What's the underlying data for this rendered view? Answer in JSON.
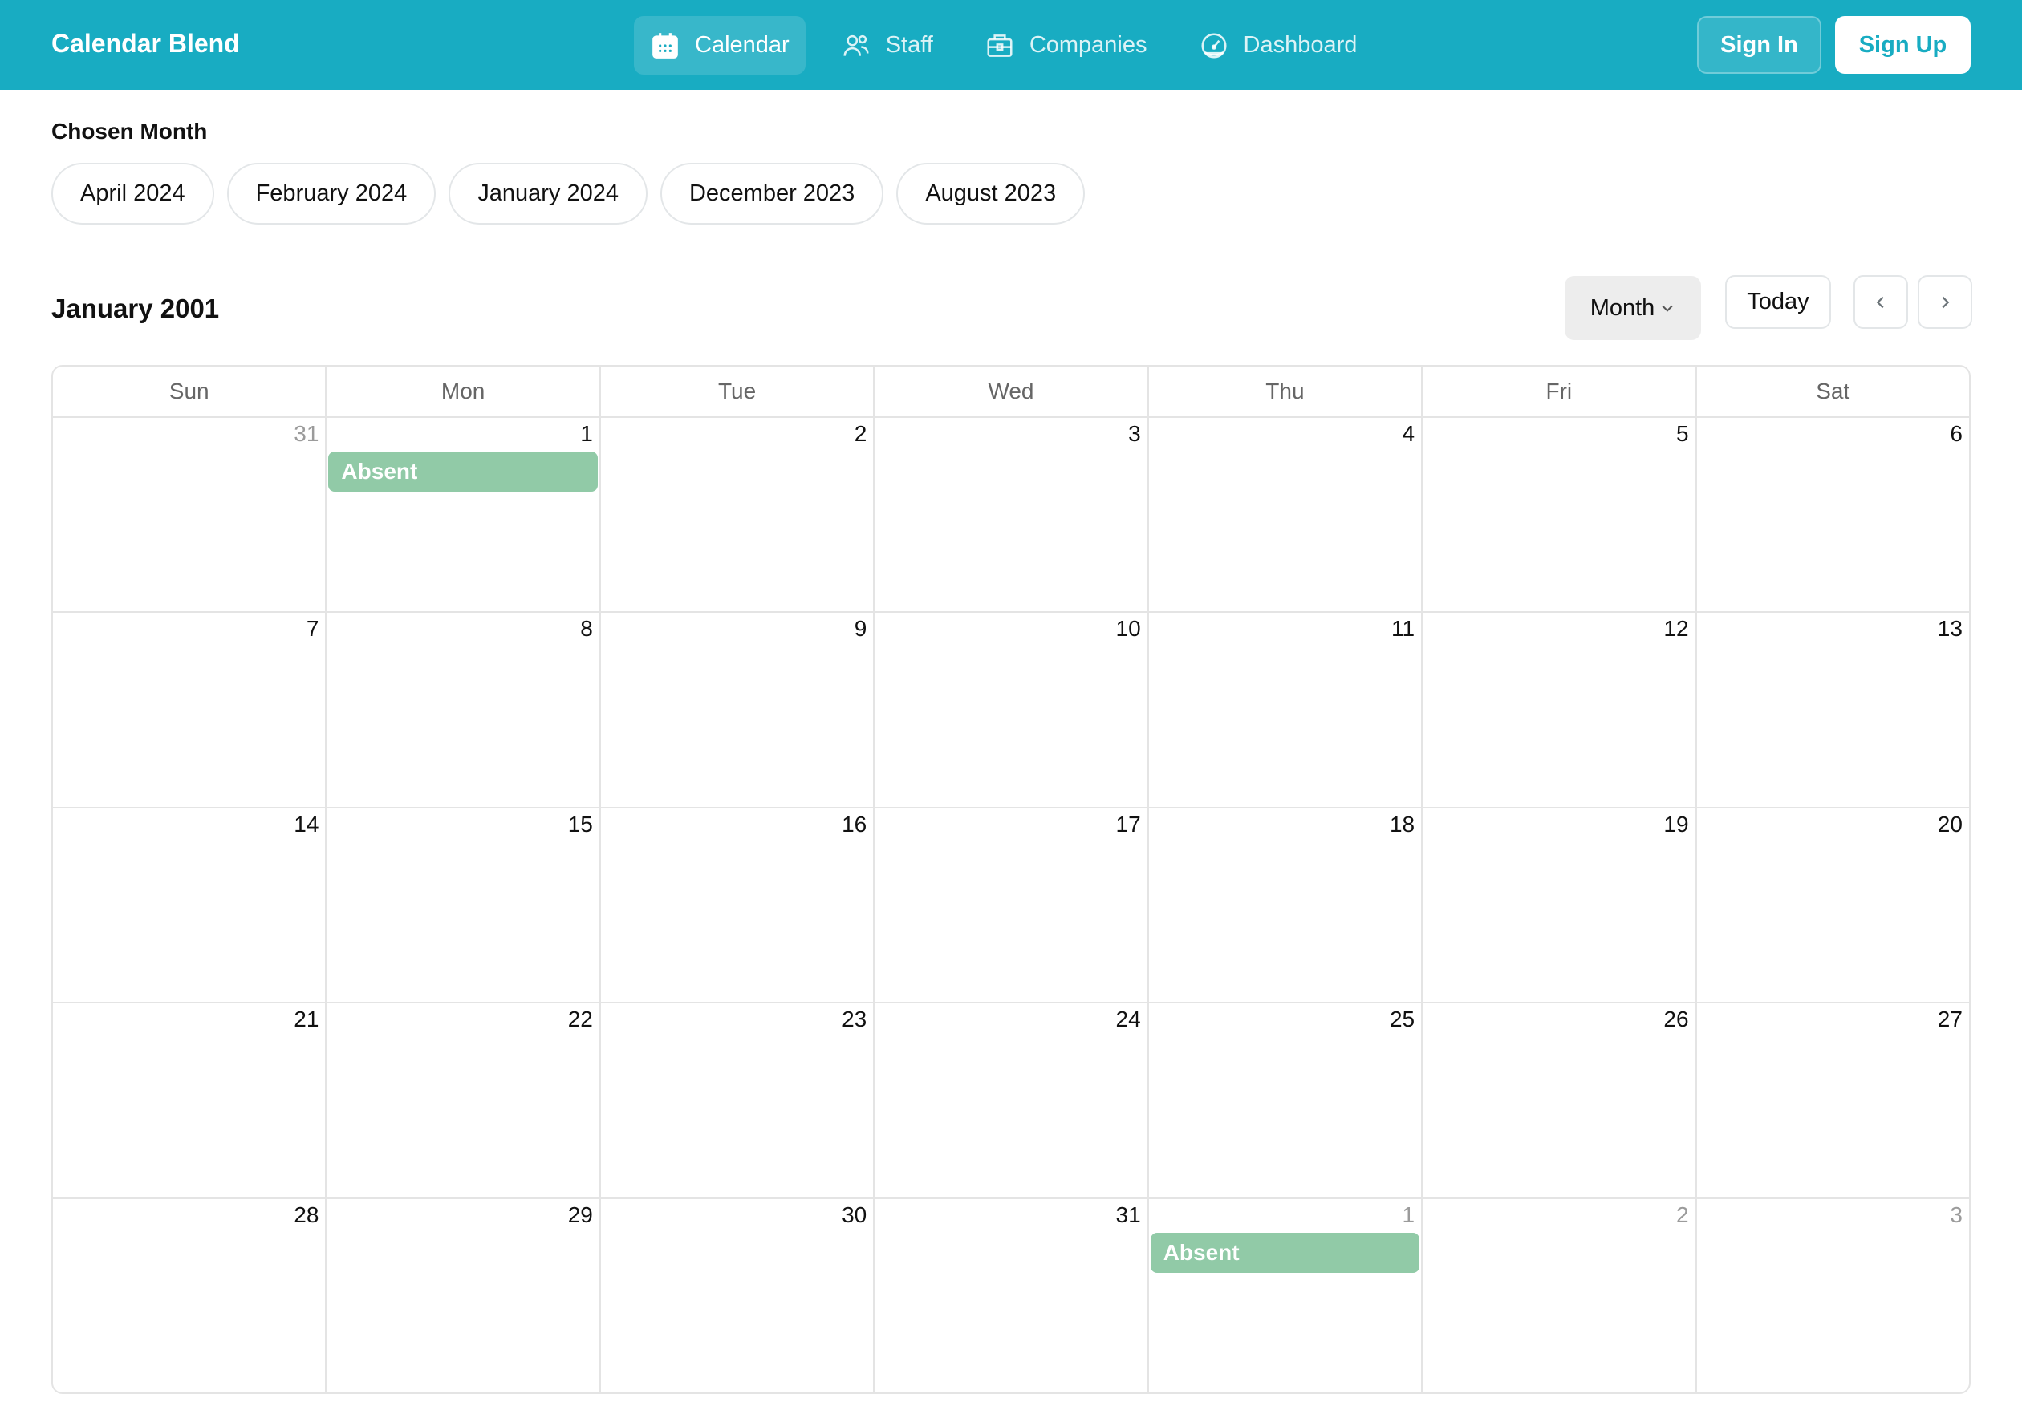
{
  "header": {
    "app_title": "Calendar Blend",
    "nav": [
      {
        "label": "Calendar",
        "icon": "calendar-icon",
        "active": true
      },
      {
        "label": "Staff",
        "icon": "users-icon",
        "active": false
      },
      {
        "label": "Companies",
        "icon": "briefcase-icon",
        "active": false
      },
      {
        "label": "Dashboard",
        "icon": "gauge-icon",
        "active": false
      }
    ],
    "sign_in_label": "Sign In",
    "sign_up_label": "Sign Up",
    "brand_color": "#18acc2"
  },
  "chosen_month": {
    "label": "Chosen Month",
    "options": [
      "April 2024",
      "February 2024",
      "January 2024",
      "December 2023",
      "August 2023"
    ]
  },
  "calendar": {
    "title": "January 2001",
    "view_label": "Month",
    "today_label": "Today",
    "prev_icon": "chevron-left-icon",
    "next_icon": "chevron-right-icon",
    "weekdays": [
      "Sun",
      "Mon",
      "Tue",
      "Wed",
      "Thu",
      "Fri",
      "Sat"
    ],
    "event_color": "#91caa7",
    "weeks": [
      [
        {
          "day": "31",
          "other": true
        },
        {
          "day": "1",
          "event": "Absent"
        },
        {
          "day": "2"
        },
        {
          "day": "3"
        },
        {
          "day": "4"
        },
        {
          "day": "5"
        },
        {
          "day": "6"
        }
      ],
      [
        {
          "day": "7"
        },
        {
          "day": "8"
        },
        {
          "day": "9"
        },
        {
          "day": "10"
        },
        {
          "day": "11"
        },
        {
          "day": "12"
        },
        {
          "day": "13"
        }
      ],
      [
        {
          "day": "14"
        },
        {
          "day": "15"
        },
        {
          "day": "16"
        },
        {
          "day": "17"
        },
        {
          "day": "18"
        },
        {
          "day": "19"
        },
        {
          "day": "20"
        }
      ],
      [
        {
          "day": "21"
        },
        {
          "day": "22"
        },
        {
          "day": "23"
        },
        {
          "day": "24"
        },
        {
          "day": "25"
        },
        {
          "day": "26"
        },
        {
          "day": "27"
        }
      ],
      [
        {
          "day": "28"
        },
        {
          "day": "29"
        },
        {
          "day": "30"
        },
        {
          "day": "31"
        },
        {
          "day": "1",
          "other": true,
          "event": "Absent"
        },
        {
          "day": "2",
          "other": true
        },
        {
          "day": "3",
          "other": true
        }
      ]
    ]
  }
}
